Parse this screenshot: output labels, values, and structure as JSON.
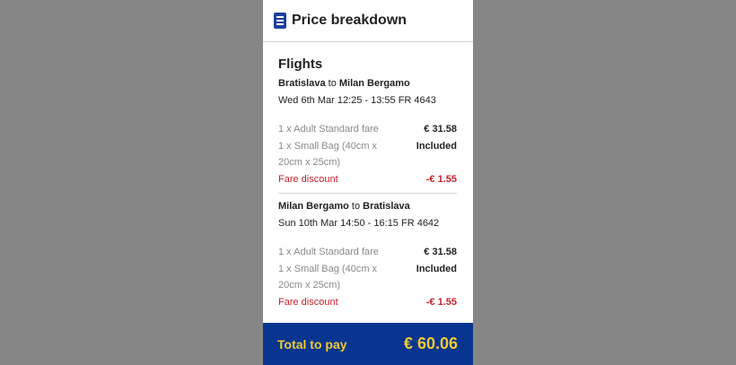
{
  "header": {
    "title": "Price breakdown",
    "icon": "document-icon"
  },
  "section_title": "Flights",
  "flights": [
    {
      "origin": "Bratislava",
      "connector": " to ",
      "destination": "Milan Bergamo",
      "schedule": "Wed 6th Mar 12:25 - 13:55 FR 4643",
      "items": [
        {
          "label": "1 x Adult Standard fare",
          "value": "€ 31.58"
        },
        {
          "label": "1 x Small Bag (40cm x 20cm x 25cm)",
          "value": "Included"
        }
      ],
      "discount": {
        "label": "Fare discount",
        "value": "-€ 1.55"
      }
    },
    {
      "origin": "Milan Bergamo",
      "connector": " to ",
      "destination": "Bratislava",
      "schedule": "Sun 10th Mar 14:50 - 16:15 FR 4642",
      "items": [
        {
          "label": "1 x Adult Standard fare",
          "value": "€ 31.58"
        },
        {
          "label": "1 x Small Bag (40cm x 20cm x 25cm)",
          "value": "Included"
        }
      ],
      "discount": {
        "label": "Fare discount",
        "value": "-€ 1.55"
      }
    }
  ],
  "total": {
    "label": "Total to pay",
    "value": "€ 60.06"
  },
  "colors": {
    "brand_blue": "#073590",
    "accent_yellow": "#F1C933",
    "discount_red": "#C8202A"
  }
}
